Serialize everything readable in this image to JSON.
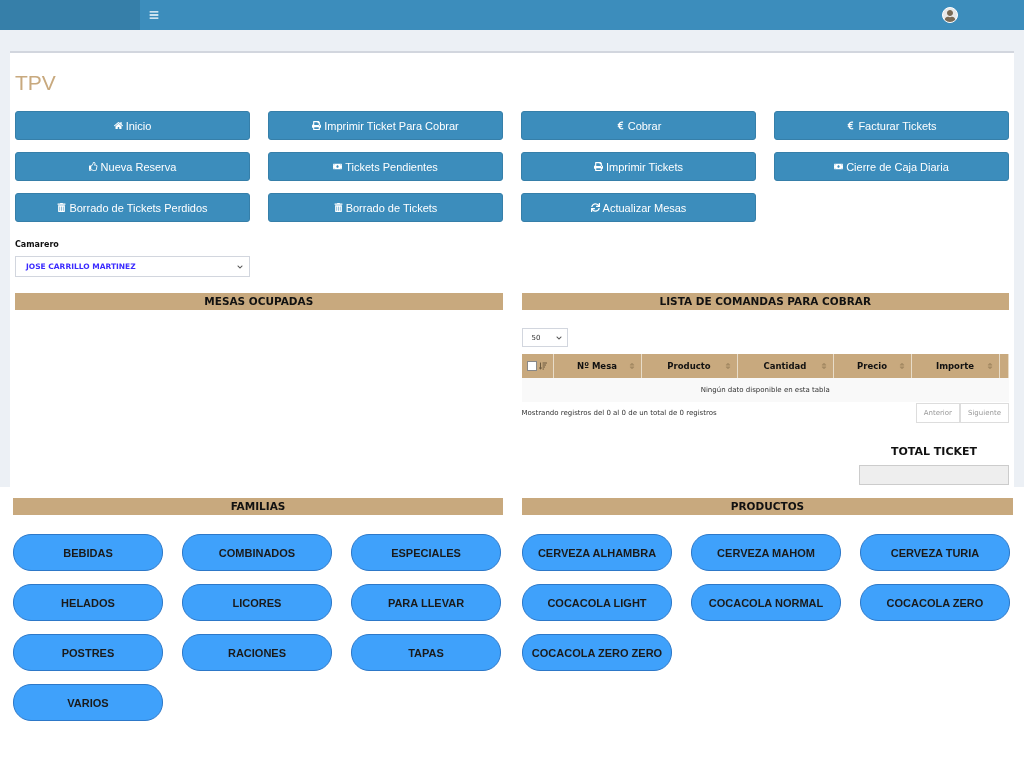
{
  "page_title": "TPV",
  "actions": [
    "Inicio",
    "Imprimir Ticket Para Cobrar",
    "Cobrar",
    "Facturar Tickets",
    "Nueva Reserva",
    "Tickets Pendientes",
    "Imprimir Tickets",
    "Cierre de Caja Diaria",
    "Borrado de Tickets Perdidos",
    "Borrado de Tickets",
    "Actualizar Mesas"
  ],
  "waiter": {
    "label": "Camarero",
    "value": "JOSE CARRILLO MARTINEZ"
  },
  "occupied_tables": {
    "title": "MESAS OCUPADAS"
  },
  "orders": {
    "title": "LISTA DE COMANDAS PARA COBRAR",
    "page_size": "50",
    "select_all_checked": false,
    "columns": [
      "Nº Mesa",
      "Producto",
      "Cantidad",
      "Precio",
      "Importe"
    ],
    "empty_message": "Ningún dato disponible en esta tabla",
    "info": "Mostrando registros del 0 al 0 de un total de 0 registros",
    "pagination": [
      {
        "label": "Anterior",
        "disabled": true
      },
      {
        "label": "Siguiente",
        "disabled": true
      }
    ],
    "total_label": "TOTAL TICKET"
  },
  "families": {
    "title": "FAMILIAS",
    "items": [
      "BEBIDAS",
      "COMBINADOS",
      "ESPECIALES",
      "HELADOS",
      "LICORES",
      "PARA LLEVAR",
      "POSTRES",
      "RACIONES",
      "TAPAS",
      "VARIOS"
    ]
  },
  "products": {
    "title": "PRODUCTOS",
    "items": [
      "CERVEZA ALHAMBRA",
      "CERVEZA MAHOM",
      "CERVEZA TURIA",
      "COCACOLA LIGHT",
      "COCACOLA NORMAL",
      "COCACOLA ZERO",
      "COCACOLA ZERO ZERO"
    ]
  }
}
